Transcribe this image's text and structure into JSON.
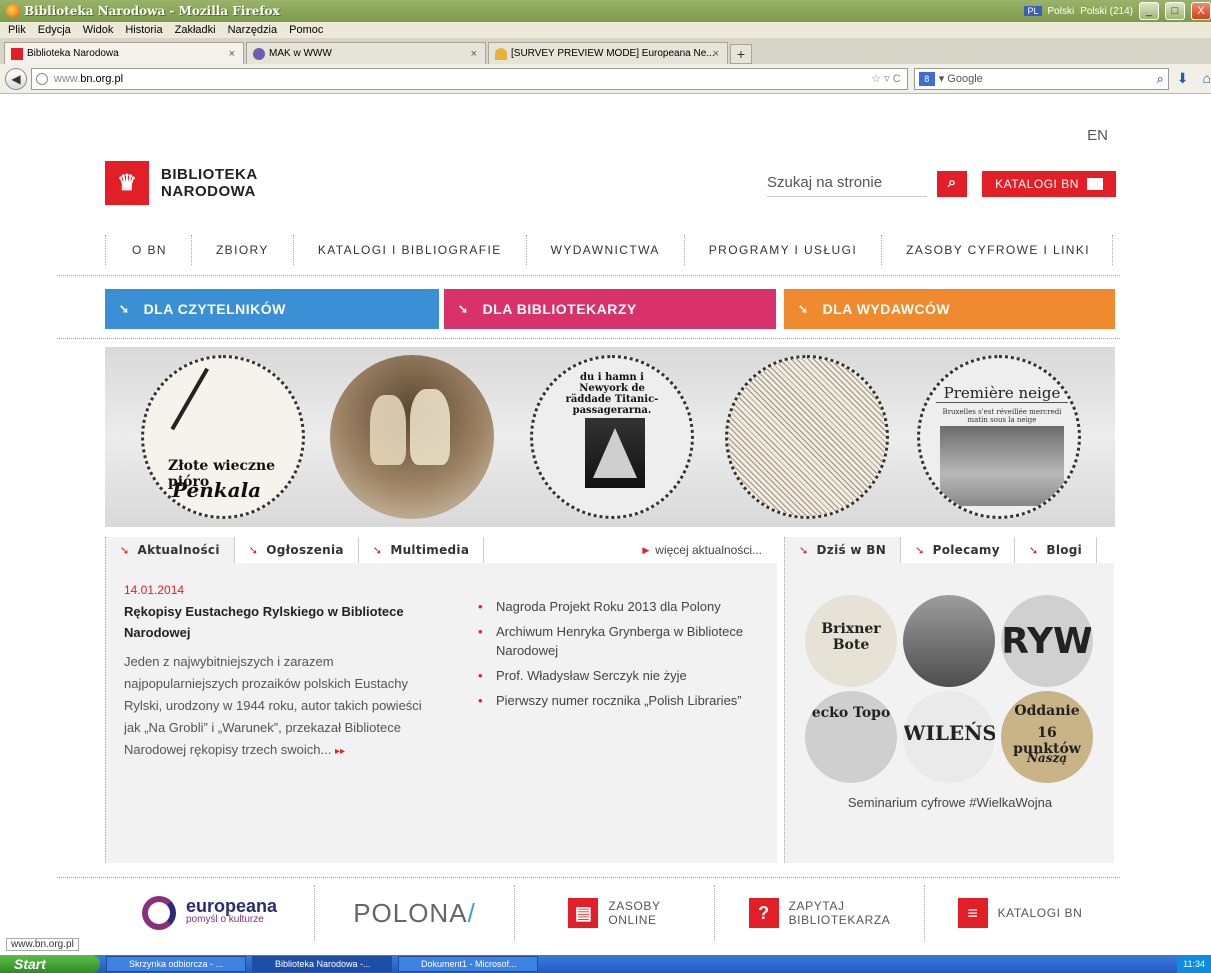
{
  "window": {
    "title": "Biblioteka Narodowa - Mozilla Firefox",
    "tray_lang": "PL",
    "tray_lang_label": "Polski",
    "tray_keyboard": "Polski (214)",
    "min": "_",
    "max": "□",
    "close": "X"
  },
  "menu": [
    "Plik",
    "Edycja",
    "Widok",
    "Historia",
    "Zakładki",
    "Narzędzia",
    "Pomoc"
  ],
  "tabs": [
    {
      "label": "Biblioteka Narodowa",
      "icon": "bn-favicon"
    },
    {
      "label": "MAK w WWW",
      "icon": "mak-favicon"
    },
    {
      "label": "[SURVEY PREVIEW MODE] Europeana Ne...",
      "icon": "survey-favicon"
    }
  ],
  "newtab": "+",
  "nav": {
    "url_prefix": "www.",
    "url_main": "bn.org.pl",
    "url_icons": "☆ ▿ C",
    "search_engine": "8",
    "search_placeholder": "▾ Google"
  },
  "site": {
    "lang_switch": "EN",
    "logo_line1": "BIBLIOTEKA",
    "logo_line2": "NARODOWA",
    "search_placeholder": "Szukaj na stronie",
    "katalogi_label": "KATALOGI BN",
    "mainnav": [
      "O BN",
      "ZBIORY",
      "KATALOGI I BIBLIOGRAFIE",
      "WYDAWNICTWA",
      "PROGRAMY I USŁUGI",
      "ZASOBY CYFROWE I LINKI"
    ],
    "audience": [
      {
        "label": "DLA CZYTELNIKÓW",
        "color": "#3b8fd4"
      },
      {
        "label": "DLA BIBLIOTEKARZY",
        "color": "#d9326a"
      },
      {
        "label": "DLA WYDAWCÓW",
        "color": "#ef8a2e"
      }
    ],
    "banner": {
      "c1_cap1": "Złote wieczne pióro",
      "c1_cap2": "Penkala",
      "c3_head": "du i hamn i Newyork de räddade Titanic-passagerarna.",
      "c5_head": "Première neige",
      "c5_sub": "Bruxelles s'est réveillée mercredi matin sous la neige"
    },
    "news_tabs": [
      "Aktualności",
      "Ogłoszenia",
      "Multimedia"
    ],
    "more_news": "więcej aktualności...",
    "news_date": "14.01.2014",
    "news_title": "Rękopisy Eustachego Rylskiego w Bibliotece Narodowej",
    "news_body": "Jeden z najwybitniejszych i zarazem najpopularniejszych prozaików polskich Eustachy Rylski, urodzony w 1944 roku, autor takich powieści jak „Na Grobli” i „Warunek”, przekazał Bibliotece Narodowej rękopisy trzech swoich...",
    "news_more_marker": "▸▸",
    "news_list": [
      "Nagroda Projekt Roku 2013 dla Polony",
      "Archiwum Henryka Grynberga w Bibliotece Narodowej",
      "Prof. Władysław Serczyk nie żyje",
      "Pierwszy numer rocznika „Polish Libraries”"
    ],
    "side_tabs": [
      "Dziś w BN",
      "Polecamy",
      "Blogi"
    ],
    "side_circles": {
      "t1": "Brixner Bote",
      "t3": "RYW",
      "t4": "ecko Topo",
      "t5": "WILEŃSI",
      "t6a": "Oddanie",
      "t6b": "16 punktów",
      "t6c": "Naszą"
    },
    "side_caption": "Seminarium cyfrowe #WielkaWojna",
    "footer": {
      "europeana_title": "europeana",
      "europeana_sub": "pomyśl o kulturze",
      "polona": "POLONA",
      "polona_slash": "/",
      "zasoby_line1": "ZASOBY",
      "zasoby_line2": "ONLINE",
      "zapytaj_icon": "?",
      "zapytaj_line1": "ZAPYTAJ",
      "zapytaj_line2": "BIBLIOTEKARZA",
      "katalogi": "KATALOGI BN"
    }
  },
  "status": "www.bn.org.pl",
  "taskbar": {
    "start": "Start",
    "tasks": [
      "Skrzynka odbiorcza - ...",
      "Biblioteka Narodowa -...",
      "Dokument1 - Microsof..."
    ],
    "clock": "11:34"
  }
}
